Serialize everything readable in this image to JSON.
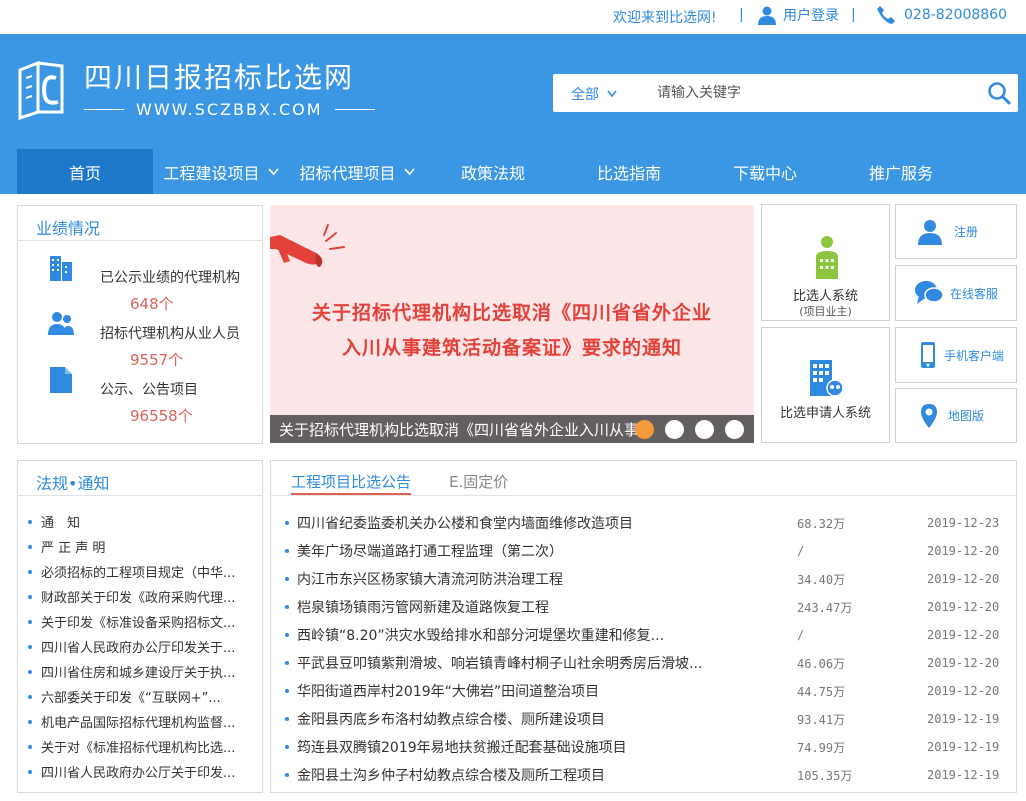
{
  "topbar": {
    "welcome": "欢迎来到比选网!",
    "separator": "|",
    "login": "用户登录",
    "phone": "028-82008860"
  },
  "logo": {
    "name": "四川日报招标比选网",
    "url": "WWW.SCZBBX.COM"
  },
  "search": {
    "scope": "全部",
    "placeholder": "请输入关键字"
  },
  "nav": [
    {
      "label": "首页"
    },
    {
      "label": "工程建设项目"
    },
    {
      "label": "招标代理项目"
    },
    {
      "label": "政策法规"
    },
    {
      "label": "比选指南"
    },
    {
      "label": "下载中心"
    },
    {
      "label": "推广服务"
    }
  ],
  "performance": {
    "title": "业绩情况",
    "items": [
      {
        "label": "已公示业绩的代理机构",
        "value": "648个"
      },
      {
        "label": "招标代理机构从业人员",
        "value": "9557个"
      },
      {
        "label": "公示、公告项目",
        "value": "96558个"
      }
    ]
  },
  "banner": {
    "line1": "关于招标代理机构比选取消《四川省省外企业",
    "line2": "入川从事建筑活动备案证》要求的通知",
    "caption": "关于招标代理机构比选取消《四川省省外企业入川从事建筑活动备案证》要求的通知",
    "active_dot": 0
  },
  "systems": {
    "owner_title": "比选人系统",
    "owner_sub": "(项目业主)",
    "applicant_title": "比选申请人系统"
  },
  "side_buttons": [
    "注册",
    "在线客服",
    "手机客户端",
    "地图版"
  ],
  "laws": {
    "title": "法规•通知",
    "items": [
      "通　知",
      "严 正 声 明",
      "必须招标的工程项目规定（中华...",
      "财政部关于印发《政府采购代理...",
      "关于印发《标准设备采购招标文...",
      "四川省人民政府办公厅印发关于...",
      "四川省住房和城乡建设厅关于执...",
      "六部委关于印发《“互联网+”...",
      "机电产品国际招标代理机构监督...",
      "关于对《标准招标代理机构比选...",
      "四川省人民政府办公厅关于印发..."
    ]
  },
  "projects": {
    "tabs": [
      "工程项目比选公告",
      "E.固定价"
    ],
    "rows": [
      {
        "name": "四川省纪委监委机关办公楼和食堂内墙面维修改造项目",
        "amount": "68.32万",
        "date": "2019-12-23"
      },
      {
        "name": "美年广场尽端道路打通工程监理（第二次）",
        "amount": "/",
        "date": "2019-12-20"
      },
      {
        "name": "内江市东兴区杨家镇大清流河防洪治理工程",
        "amount": "34.40万",
        "date": "2019-12-20"
      },
      {
        "name": "桤泉镇场镇雨污管网新建及道路恢复工程",
        "amount": "243.47万",
        "date": "2019-12-20"
      },
      {
        "name": "西岭镇“8.20”洪灾水毁给排水和部分河堤堡坎重建和修复...",
        "amount": "/",
        "date": "2019-12-20"
      },
      {
        "name": "平武县豆叩镇紫荆滑坡、响岩镇青峰村桐子山社余明秀房后滑坡...",
        "amount": "46.06万",
        "date": "2019-12-20"
      },
      {
        "name": "华阳街道西岸村2019年“大佛岩”田间道整治项目",
        "amount": "44.75万",
        "date": "2019-12-20"
      },
      {
        "name": "金阳县丙底乡布洛村幼教点综合楼、厕所建设项目",
        "amount": "93.41万",
        "date": "2019-12-19"
      },
      {
        "name": "筠连县双腾镇2019年易地扶贫搬迁配套基础设施项目",
        "amount": "74.99万",
        "date": "2019-12-19"
      },
      {
        "name": "金阳县土沟乡仲子村幼教点综合楼及厕所工程项目",
        "amount": "105.35万",
        "date": "2019-12-19"
      }
    ]
  },
  "colors": {
    "brand_blue": "#3b97e4",
    "nav_active": "#1d78c9",
    "accent_red": "#e0605a",
    "icon_blue": "#2f8ae0",
    "icon_green": "#8cc63f"
  }
}
